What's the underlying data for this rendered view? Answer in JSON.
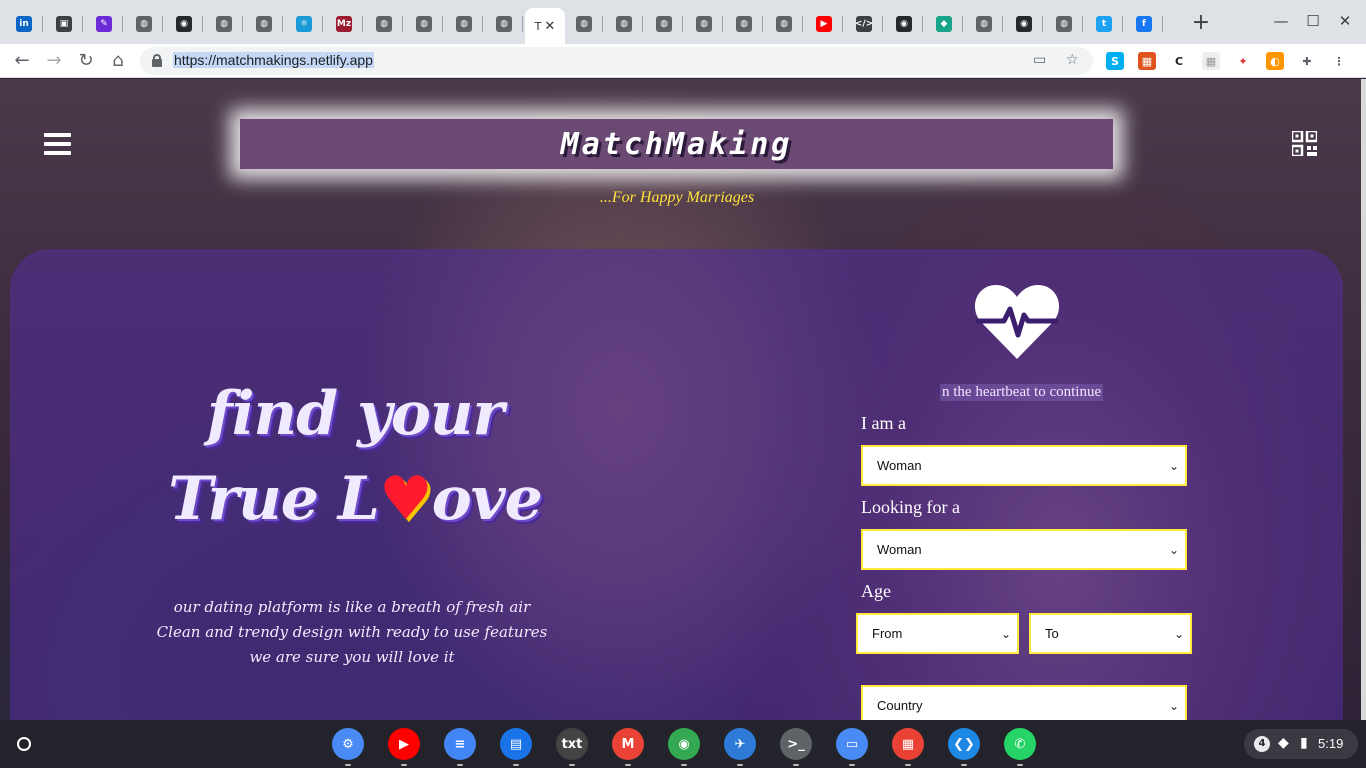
{
  "browser": {
    "tabs": [
      {
        "icon": "linkedin-icon",
        "color": "#0a66c2",
        "glyph": "in"
      },
      {
        "icon": "briefcase-icon",
        "color": "#3c4043",
        "glyph": "▣"
      },
      {
        "icon": "pencil-app-icon",
        "color": "#6b2bd6",
        "glyph": "✎"
      },
      {
        "icon": "globe-icon",
        "color": "#5f6368",
        "glyph": "◍"
      },
      {
        "icon": "github-icon",
        "color": "#24292e",
        "glyph": "◉"
      },
      {
        "icon": "globe-icon",
        "color": "#5f6368",
        "glyph": "◍"
      },
      {
        "icon": "globe-icon",
        "color": "#5f6368",
        "glyph": "◍"
      },
      {
        "icon": "react-icon",
        "color": "#1a9bd7",
        "glyph": "⚛"
      },
      {
        "icon": "mz-icon",
        "color": "#9b1b30",
        "glyph": "Mz"
      },
      {
        "icon": "globe-icon",
        "color": "#5f6368",
        "glyph": "◍"
      },
      {
        "icon": "globe-icon",
        "color": "#5f6368",
        "glyph": "◍"
      },
      {
        "icon": "globe-icon",
        "color": "#5f6368",
        "glyph": "◍"
      },
      {
        "icon": "globe-icon",
        "color": "#5f6368",
        "glyph": "◍"
      },
      {
        "icon": "active-tab",
        "color": "#fff",
        "glyph": "T"
      },
      {
        "icon": "globe-icon",
        "color": "#5f6368",
        "glyph": "◍"
      },
      {
        "icon": "globe-icon",
        "color": "#5f6368",
        "glyph": "◍"
      },
      {
        "icon": "globe-icon",
        "color": "#5f6368",
        "glyph": "◍"
      },
      {
        "icon": "globe-icon",
        "color": "#5f6368",
        "glyph": "◍"
      },
      {
        "icon": "globe-icon",
        "color": "#5f6368",
        "glyph": "◍"
      },
      {
        "icon": "globe-icon",
        "color": "#5f6368",
        "glyph": "◍"
      },
      {
        "icon": "youtube-icon",
        "color": "#ff0000",
        "glyph": "▶"
      },
      {
        "icon": "code-icon",
        "color": "#3c4043",
        "glyph": "</>"
      },
      {
        "icon": "github-icon",
        "color": "#24292e",
        "glyph": "◉"
      },
      {
        "icon": "diamond-icon",
        "color": "#17a589",
        "glyph": "◆"
      },
      {
        "icon": "globe-icon",
        "color": "#5f6368",
        "glyph": "◍"
      },
      {
        "icon": "github-icon",
        "color": "#24292e",
        "glyph": "◉"
      },
      {
        "icon": "globe-icon",
        "color": "#5f6368",
        "glyph": "◍"
      },
      {
        "icon": "twitter-icon",
        "color": "#1da1f2",
        "glyph": "t"
      },
      {
        "icon": "facebook-icon",
        "color": "#1877f2",
        "glyph": "f"
      }
    ],
    "active_tab_label": "T",
    "url": "https://matchmakings.netlify.app"
  },
  "site": {
    "brand": "MatchMaking",
    "tagline": "...For Happy Marriages",
    "hero_line1": "find your",
    "hero_line2_prefix": "True L",
    "hero_line2_heart": "♥",
    "hero_line2_suffix": "ove",
    "blurb": [
      "our dating platform is like a breath of fresh air",
      "Clean and trendy design with ready to use features",
      "we are sure you will love it"
    ],
    "pulse_hint": "n the heartbeat to continue",
    "form": {
      "iam_label": "I am a",
      "iam_value": "Woman",
      "looking_label": "Looking for a",
      "looking_value": "Woman",
      "age_label": "Age",
      "age_from": "From",
      "age_to": "To",
      "country": "Country"
    },
    "accent_color": "#ffeb3b",
    "panel_color": "#562da0"
  },
  "shelf": {
    "apps": [
      {
        "name": "settings-app",
        "color": "#4a8af4",
        "glyph": "⚙"
      },
      {
        "name": "youtube-app",
        "color": "#ff0000",
        "glyph": "▶"
      },
      {
        "name": "docs-app",
        "color": "#4285f4",
        "glyph": "≡"
      },
      {
        "name": "chat-app",
        "color": "#1a73e8",
        "glyph": "▤"
      },
      {
        "name": "text-app",
        "color": "#444",
        "glyph": "txt"
      },
      {
        "name": "gmail-app",
        "color": "#ea4335",
        "glyph": "M"
      },
      {
        "name": "chrome-app",
        "color": "#34a853",
        "glyph": "◉"
      },
      {
        "name": "feedly-app",
        "color": "#2d7bd6",
        "glyph": "✈"
      },
      {
        "name": "terminal-app",
        "color": "#5f6368",
        "glyph": ">_"
      },
      {
        "name": "files-app",
        "color": "#4a8af4",
        "glyph": "▭"
      },
      {
        "name": "screencast-app",
        "color": "#e94235",
        "glyph": "▦"
      },
      {
        "name": "vscode-app",
        "color": "#1e88e5",
        "glyph": "❮❯"
      },
      {
        "name": "whatsapp-app",
        "color": "#25d366",
        "glyph": "✆"
      }
    ],
    "notification_count": "4",
    "time": "5:19"
  }
}
